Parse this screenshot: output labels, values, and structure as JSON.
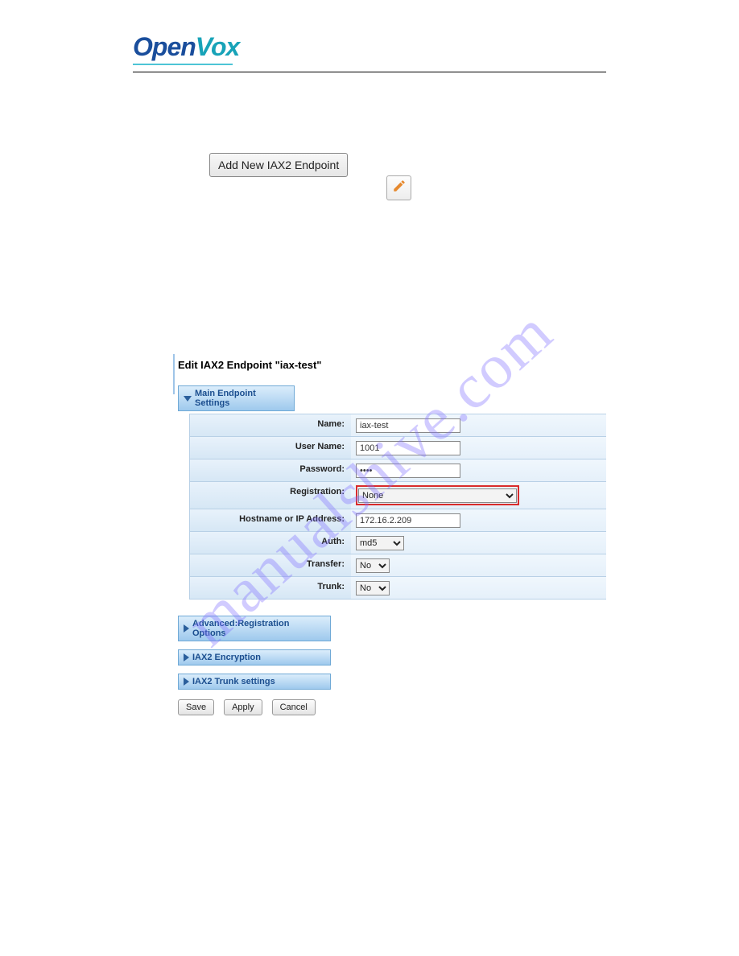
{
  "logo": {
    "open": "Open",
    "vox": "Vox"
  },
  "add_button_label": "Add New IAX2 Endpoint",
  "pencil_icon_name": "pencil-icon",
  "watermark_text": "manualshive.com",
  "form": {
    "title": "Edit IAX2 Endpoint \"iax-test\"",
    "main_section_label": "Main Endpoint Settings",
    "fields": {
      "name": {
        "label": "Name:",
        "value": "iax-test"
      },
      "user_name": {
        "label": "User Name:",
        "value": "1001"
      },
      "password": {
        "label": "Password:",
        "value": "••••"
      },
      "registration": {
        "label": "Registration:",
        "value": "None"
      },
      "hostname": {
        "label": "Hostname or IP Address:",
        "value": "172.16.2.209"
      },
      "auth": {
        "label": "Auth:",
        "value": "md5"
      },
      "transfer": {
        "label": "Transfer:",
        "value": "No"
      },
      "trunk": {
        "label": "Trunk:",
        "value": "No"
      }
    },
    "closed_sections": {
      "adv_reg": "Advanced:Registration Options",
      "iax_enc": "IAX2 Encryption",
      "iax_trunk": "IAX2 Trunk settings"
    },
    "buttons": {
      "save": "Save",
      "apply": "Apply",
      "cancel": "Cancel"
    }
  }
}
